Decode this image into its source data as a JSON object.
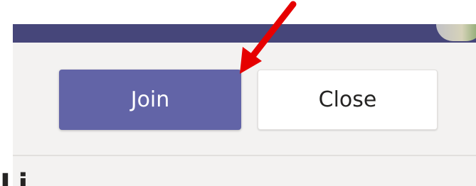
{
  "header": {
    "bar_color": "#46467a",
    "avatar_icon": "avatar-icon"
  },
  "actions": {
    "join_label": "Join",
    "close_label": "Close",
    "join_color": "#6264a7"
  },
  "content": {
    "partial_heading": "Li"
  },
  "annotation": {
    "arrow_color": "#e60000",
    "arrow_icon": "arrow-pointer-icon"
  }
}
